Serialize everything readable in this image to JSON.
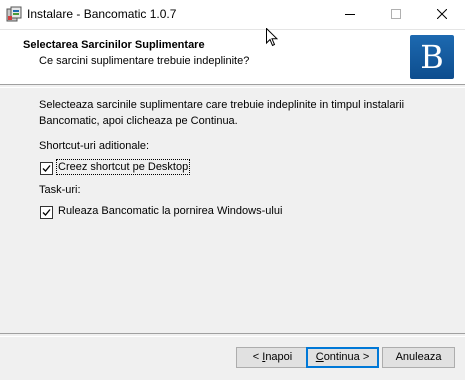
{
  "window": {
    "title": "Instalare - Bancomatic 1.0.7",
    "icon": "installer-icon",
    "controls": [
      "minimize-icon",
      "maximize-icon",
      "close-icon"
    ]
  },
  "header": {
    "title": "Selectarea Sarcinilor Suplimentare",
    "subtitle": "Ce sarcini suplimentare trebuie indeplinite?",
    "logo_letter": "B",
    "logo_color": "#1560a8"
  },
  "content": {
    "intro": "Selecteaza sarcinile suplimentare care trebuie indeplinite in timpul instalarii Bancomatic, apoi clicheaza pe Continua.",
    "groups": [
      {
        "label": "Shortcut-uri aditionale:",
        "items": [
          {
            "label": "Creez shortcut pe Desktop",
            "checked": true
          }
        ]
      },
      {
        "label": "Task-uri:",
        "items": [
          {
            "label": "Ruleaza Bancomatic la pornirea Windows-ului",
            "checked": true
          }
        ]
      }
    ]
  },
  "footer": {
    "back": {
      "prefix": "< ",
      "mnemonic": "I",
      "rest": "napoi"
    },
    "next": {
      "mnemonic": "C",
      "rest": "ontinua",
      "suffix": " >"
    },
    "cancel": "Anuleaza",
    "accent_color": "#0078d7"
  }
}
